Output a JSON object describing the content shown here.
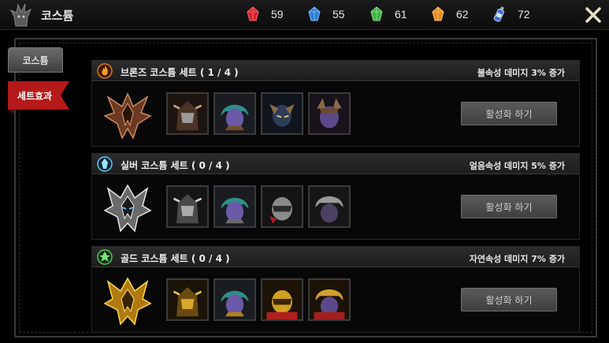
{
  "header": {
    "title": "코스튬"
  },
  "resources": [
    {
      "icon": "red-gem-icon",
      "value": "59",
      "color": "#d8222e"
    },
    {
      "icon": "blue-gem-icon",
      "value": "55",
      "color": "#2f7fd8"
    },
    {
      "icon": "green-gem-icon",
      "value": "61",
      "color": "#3fb43f"
    },
    {
      "icon": "orange-gem-icon",
      "value": "62",
      "color": "#e98b1f"
    },
    {
      "icon": "potion-bottle-icon",
      "value": "72",
      "color": "#3b6fd0"
    }
  ],
  "tabs": [
    {
      "label": "코스튬",
      "active": false
    },
    {
      "label": "세트효과",
      "active": true
    }
  ],
  "sets": [
    {
      "name": "브론즈 코스튬 세트 ( 1 / 4 )",
      "effect": "불속성 데미지 3% 증가",
      "button": "활성화 하기",
      "icon": "fire-element-icon",
      "tint": "#b9693f"
    },
    {
      "name": "실버 코스튬 세트 ( 0 / 4 )",
      "effect": "얼음속성 데미지 5% 증가",
      "button": "활성화 하기",
      "icon": "ice-element-icon",
      "tint": "#c8c8c8"
    },
    {
      "name": "골드 코스튬 세트 ( 0 / 4 )",
      "effect": "자연속성 데미지 7% 증가",
      "button": "활성화 하기",
      "icon": "nature-element-icon",
      "tint": "#d9a21a"
    }
  ]
}
